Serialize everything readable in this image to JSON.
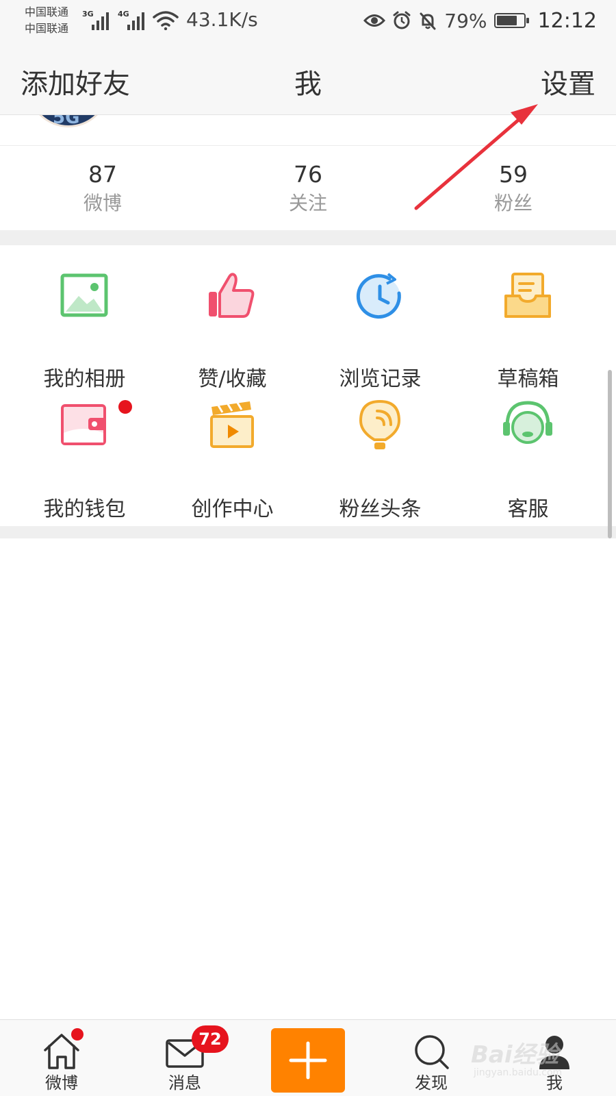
{
  "status_bar": {
    "carrier_1": "中国联通",
    "carrier_2": "中国联通",
    "network_1": "3G",
    "network_2": "4G",
    "speed": "43.1K/s",
    "battery": "79%",
    "battery_level": 0.79,
    "time": "12:12"
  },
  "nav": {
    "left": "添加好友",
    "title": "我",
    "right": "设置"
  },
  "stats": [
    {
      "value": "87",
      "label": "微博"
    },
    {
      "value": "76",
      "label": "关注"
    },
    {
      "value": "59",
      "label": "粉丝"
    }
  ],
  "grid": [
    {
      "label": "我的相册",
      "icon": "photo-album-icon"
    },
    {
      "label": "赞/收藏",
      "icon": "thumbs-up-icon"
    },
    {
      "label": "浏览记录",
      "icon": "history-clock-icon"
    },
    {
      "label": "草稿箱",
      "icon": "drafts-tray-icon"
    },
    {
      "label": "我的钱包",
      "icon": "wallet-icon"
    },
    {
      "label": "创作中心",
      "icon": "clapperboard-icon"
    },
    {
      "label": "粉丝头条",
      "icon": "hot-air-balloon-icon"
    },
    {
      "label": "客服",
      "icon": "headset-icon"
    }
  ],
  "tab_bar": {
    "tabs": [
      {
        "label": "微博",
        "icon": "home-icon"
      },
      {
        "label": "消息",
        "icon": "mail-icon",
        "badge": "72"
      },
      {
        "label": "发现",
        "icon": "search-icon"
      },
      {
        "label": "我",
        "icon": "profile-icon"
      }
    ],
    "compose_icon": "plus-icon"
  },
  "watermark": {
    "main": "Bai经验",
    "sub": "jingyan.baidu.com"
  },
  "colors": {
    "accent_orange": "#ff8200",
    "badge_red": "#e6141e",
    "annotation_red": "#e8323c"
  }
}
